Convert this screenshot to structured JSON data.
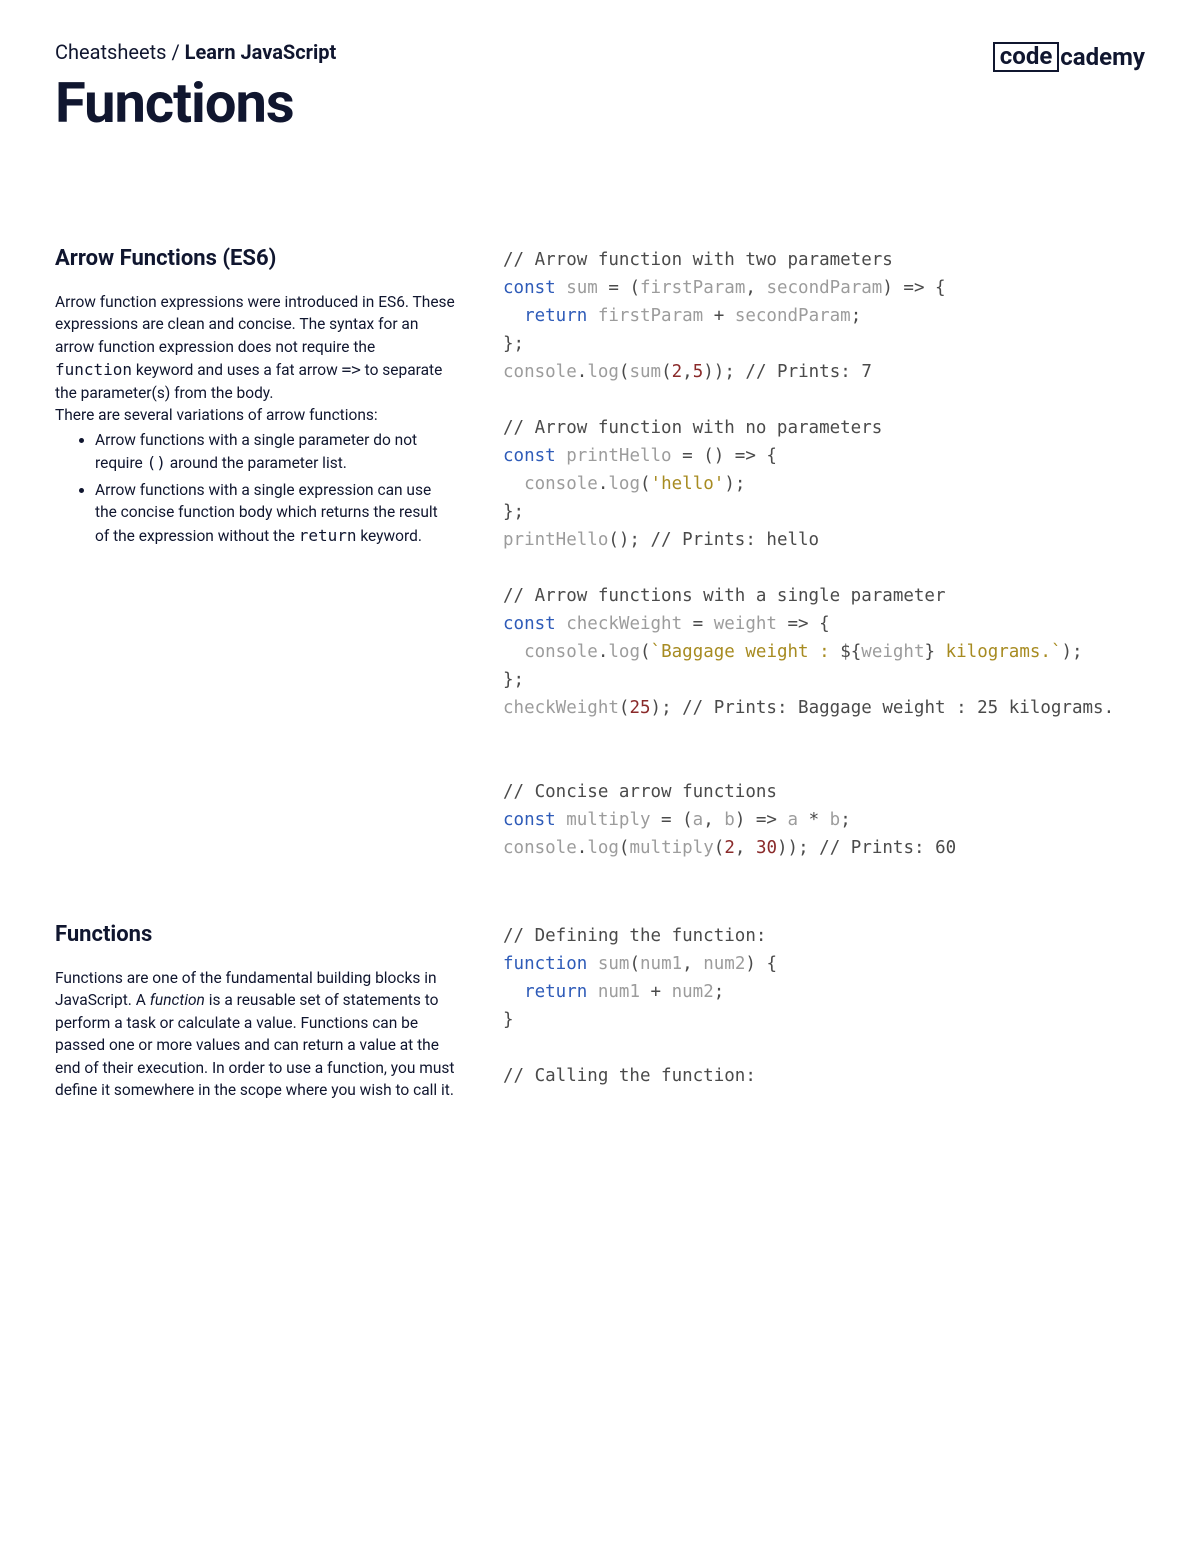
{
  "header": {
    "breadcrumb_root": "Cheatsheets",
    "breadcrumb_sep": " / ",
    "breadcrumb_current": "Learn JavaScript",
    "title": "Functions",
    "logo_box": "code",
    "logo_rest": "cademy"
  },
  "sections": {
    "arrow": {
      "heading": "Arrow Functions (ES6)",
      "p1_a": "Arrow function expressions were introduced in ES6. These expressions are clean and concise. The syntax for an arrow function expression does not require the ",
      "p1_code1": "function",
      "p1_b": " keyword and uses a fat arrow ",
      "p1_code2": "=>",
      "p1_c": " to separate the parameter(s) from the body.",
      "p2": "There are several variations of arrow functions:",
      "li1_a": "Arrow functions with a single parameter do not require ",
      "li1_code": "()",
      "li1_b": " around the parameter list.",
      "li2_a": "Arrow functions with a single expression can use the concise function body which returns the result of the expression without the ",
      "li2_code": "return",
      "li2_b": " keyword.",
      "code_tokens": [
        {
          "cls": "tok-comment",
          "t": "// Arrow function with two parameters"
        },
        {
          "cls": "",
          "t": "\n"
        },
        {
          "cls": "tok-kw",
          "t": "const"
        },
        {
          "cls": "tok-id",
          "t": " sum "
        },
        {
          "cls": "tok-punct",
          "t": "= "
        },
        {
          "cls": "tok-punct",
          "t": "("
        },
        {
          "cls": "tok-id",
          "t": "firstParam"
        },
        {
          "cls": "tok-punct",
          "t": ", "
        },
        {
          "cls": "tok-id",
          "t": "secondParam"
        },
        {
          "cls": "tok-punct",
          "t": ") => {"
        },
        {
          "cls": "",
          "t": "\n  "
        },
        {
          "cls": "tok-kw",
          "t": "return"
        },
        {
          "cls": "tok-id",
          "t": " firstParam "
        },
        {
          "cls": "tok-punct",
          "t": "+ "
        },
        {
          "cls": "tok-id",
          "t": "secondParam"
        },
        {
          "cls": "tok-punct",
          "t": ";"
        },
        {
          "cls": "",
          "t": "\n"
        },
        {
          "cls": "tok-punct",
          "t": "};"
        },
        {
          "cls": "",
          "t": "\n"
        },
        {
          "cls": "tok-id",
          "t": "console"
        },
        {
          "cls": "tok-punct",
          "t": "."
        },
        {
          "cls": "tok-id",
          "t": "log"
        },
        {
          "cls": "tok-punct",
          "t": "("
        },
        {
          "cls": "tok-id",
          "t": "sum"
        },
        {
          "cls": "tok-punct",
          "t": "("
        },
        {
          "cls": "tok-num",
          "t": "2"
        },
        {
          "cls": "tok-punct",
          "t": ","
        },
        {
          "cls": "tok-num",
          "t": "5"
        },
        {
          "cls": "tok-punct",
          "t": ")); "
        },
        {
          "cls": "tok-comment",
          "t": "// Prints: 7"
        },
        {
          "cls": "",
          "t": "\n\n"
        },
        {
          "cls": "tok-comment",
          "t": "// Arrow function with no parameters"
        },
        {
          "cls": "",
          "t": "\n"
        },
        {
          "cls": "tok-kw",
          "t": "const"
        },
        {
          "cls": "tok-id",
          "t": " printHello "
        },
        {
          "cls": "tok-punct",
          "t": "= () => {"
        },
        {
          "cls": "",
          "t": "\n  "
        },
        {
          "cls": "tok-id",
          "t": "console"
        },
        {
          "cls": "tok-punct",
          "t": "."
        },
        {
          "cls": "tok-id",
          "t": "log"
        },
        {
          "cls": "tok-punct",
          "t": "("
        },
        {
          "cls": "tok-str",
          "t": "'hello'"
        },
        {
          "cls": "tok-punct",
          "t": ");"
        },
        {
          "cls": "",
          "t": "\n"
        },
        {
          "cls": "tok-punct",
          "t": "};"
        },
        {
          "cls": "",
          "t": "\n"
        },
        {
          "cls": "tok-id",
          "t": "printHello"
        },
        {
          "cls": "tok-punct",
          "t": "(); "
        },
        {
          "cls": "tok-comment",
          "t": "// Prints: hello"
        },
        {
          "cls": "",
          "t": "\n\n"
        },
        {
          "cls": "tok-comment",
          "t": "// Arrow functions with a single parameter"
        },
        {
          "cls": "",
          "t": "\n"
        },
        {
          "cls": "tok-kw",
          "t": "const"
        },
        {
          "cls": "tok-id",
          "t": " checkWeight "
        },
        {
          "cls": "tok-punct",
          "t": "= "
        },
        {
          "cls": "tok-id",
          "t": "weight"
        },
        {
          "cls": "tok-punct",
          "t": " => {"
        },
        {
          "cls": "",
          "t": "\n  "
        },
        {
          "cls": "tok-id",
          "t": "console"
        },
        {
          "cls": "tok-punct",
          "t": "."
        },
        {
          "cls": "tok-id",
          "t": "log"
        },
        {
          "cls": "tok-punct",
          "t": "("
        },
        {
          "cls": "tok-str",
          "t": "`Baggage weight : "
        },
        {
          "cls": "tok-punct",
          "t": "${"
        },
        {
          "cls": "tok-id",
          "t": "weight"
        },
        {
          "cls": "tok-punct",
          "t": "}"
        },
        {
          "cls": "tok-str",
          "t": " kilograms.`"
        },
        {
          "cls": "tok-punct",
          "t": ");"
        },
        {
          "cls": "",
          "t": "\n"
        },
        {
          "cls": "tok-punct",
          "t": "};"
        },
        {
          "cls": "",
          "t": "\n"
        },
        {
          "cls": "tok-id",
          "t": "checkWeight"
        },
        {
          "cls": "tok-punct",
          "t": "("
        },
        {
          "cls": "tok-num",
          "t": "25"
        },
        {
          "cls": "tok-punct",
          "t": "); "
        },
        {
          "cls": "tok-comment",
          "t": "// Prints: Baggage weight : 25 kilograms."
        },
        {
          "cls": "",
          "t": "\n\n\n"
        },
        {
          "cls": "tok-comment",
          "t": "// Concise arrow functions"
        },
        {
          "cls": "",
          "t": "\n"
        },
        {
          "cls": "tok-kw",
          "t": "const"
        },
        {
          "cls": "tok-id",
          "t": " multiply "
        },
        {
          "cls": "tok-punct",
          "t": "= ("
        },
        {
          "cls": "tok-id",
          "t": "a"
        },
        {
          "cls": "tok-punct",
          "t": ", "
        },
        {
          "cls": "tok-id",
          "t": "b"
        },
        {
          "cls": "tok-punct",
          "t": ") => "
        },
        {
          "cls": "tok-id",
          "t": "a "
        },
        {
          "cls": "tok-punct",
          "t": "* "
        },
        {
          "cls": "tok-id",
          "t": "b"
        },
        {
          "cls": "tok-punct",
          "t": ";"
        },
        {
          "cls": "",
          "t": "\n"
        },
        {
          "cls": "tok-id",
          "t": "console"
        },
        {
          "cls": "tok-punct",
          "t": "."
        },
        {
          "cls": "tok-id",
          "t": "log"
        },
        {
          "cls": "tok-punct",
          "t": "("
        },
        {
          "cls": "tok-id",
          "t": "multiply"
        },
        {
          "cls": "tok-punct",
          "t": "("
        },
        {
          "cls": "tok-num",
          "t": "2"
        },
        {
          "cls": "tok-punct",
          "t": ", "
        },
        {
          "cls": "tok-num",
          "t": "30"
        },
        {
          "cls": "tok-punct",
          "t": ")); "
        },
        {
          "cls": "tok-comment",
          "t": "// Prints: 60"
        }
      ]
    },
    "functions": {
      "heading": "Functions",
      "p_a": "Functions are one of the fundamental building blocks in JavaScript. A ",
      "p_em": "function",
      "p_b": " is a reusable set of statements to perform a task or calculate a value. Functions can be passed one or more values and can return a value at the end of their execution. In order to use a function, you must define it somewhere in the scope where you wish to call it.",
      "code_tokens": [
        {
          "cls": "tok-comment",
          "t": "// Defining the function:"
        },
        {
          "cls": "",
          "t": "\n"
        },
        {
          "cls": "tok-kw",
          "t": "function"
        },
        {
          "cls": "tok-id",
          "t": " sum"
        },
        {
          "cls": "tok-punct",
          "t": "("
        },
        {
          "cls": "tok-id",
          "t": "num1"
        },
        {
          "cls": "tok-punct",
          "t": ", "
        },
        {
          "cls": "tok-id",
          "t": "num2"
        },
        {
          "cls": "tok-punct",
          "t": ") {"
        },
        {
          "cls": "",
          "t": "\n  "
        },
        {
          "cls": "tok-kw",
          "t": "return"
        },
        {
          "cls": "tok-id",
          "t": " num1 "
        },
        {
          "cls": "tok-punct",
          "t": "+ "
        },
        {
          "cls": "tok-id",
          "t": "num2"
        },
        {
          "cls": "tok-punct",
          "t": ";"
        },
        {
          "cls": "",
          "t": "\n"
        },
        {
          "cls": "tok-punct",
          "t": "}"
        },
        {
          "cls": "",
          "t": "\n\n"
        },
        {
          "cls": "tok-comment",
          "t": "// Calling the function:"
        }
      ]
    }
  }
}
